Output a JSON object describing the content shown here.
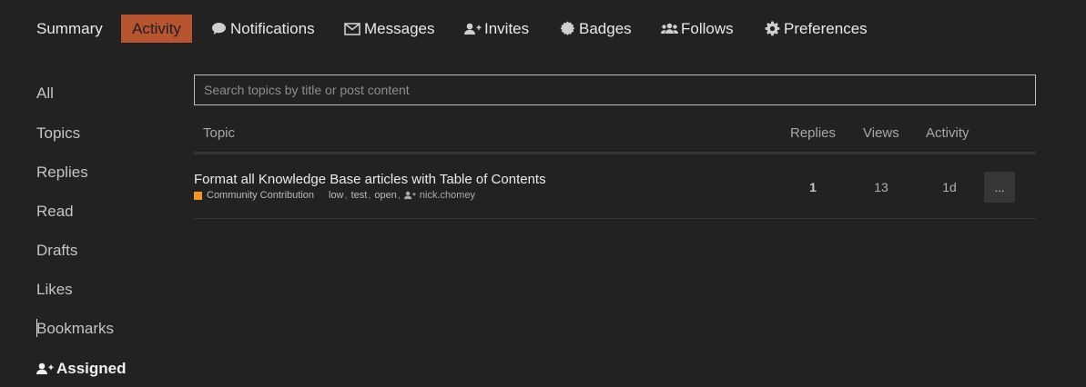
{
  "nav": {
    "summary": "Summary",
    "activity": "Activity",
    "notifications": "Notifications",
    "messages": "Messages",
    "invites": "Invites",
    "badges": "Badges",
    "follows": "Follows",
    "preferences": "Preferences",
    "active": "activity",
    "active_color": "#b8542f"
  },
  "sidebar": {
    "items": [
      {
        "label": "All"
      },
      {
        "label": "Topics"
      },
      {
        "label": "Replies"
      },
      {
        "label": "Read"
      },
      {
        "label": "Drafts"
      },
      {
        "label": "Likes"
      },
      {
        "label": "Bookmarks"
      },
      {
        "label": "Assigned",
        "icon": "user-plus-icon",
        "active": true
      }
    ]
  },
  "search": {
    "placeholder": "Search topics by title or post content",
    "value": ""
  },
  "table": {
    "columns": {
      "topic": "Topic",
      "replies": "Replies",
      "views": "Views",
      "activity": "Activity"
    },
    "rows": [
      {
        "title": "Format all Knowledge Base articles with Table of Contents",
        "category": "Community Contribution",
        "category_color": "#f7941d",
        "tags": [
          "low",
          "test",
          "open"
        ],
        "assignee": "nick.chomey",
        "replies": "1",
        "views": "13",
        "activity": "1d",
        "more_label": "..."
      }
    ]
  }
}
